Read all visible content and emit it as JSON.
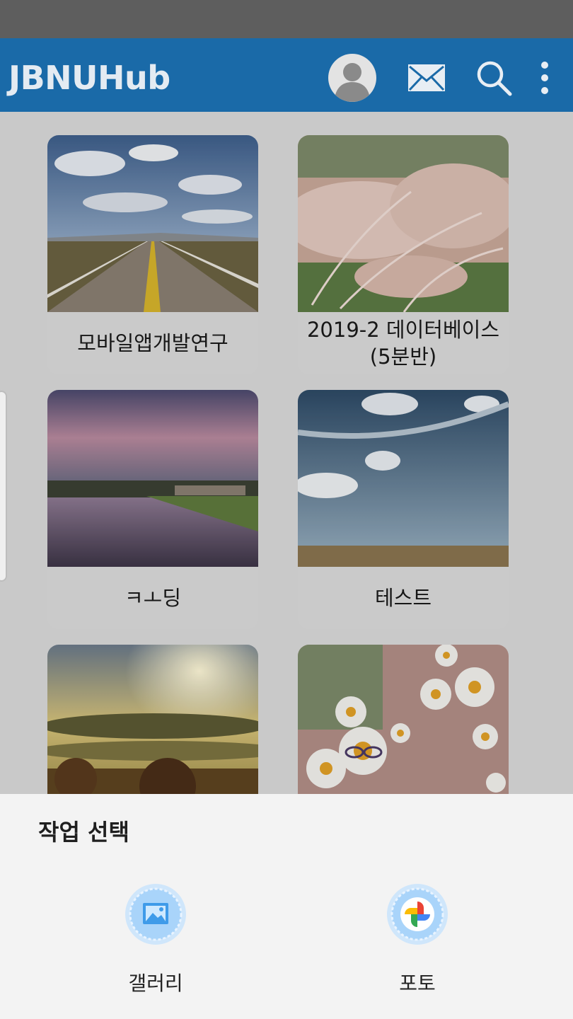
{
  "app": {
    "title": "JBNUHub"
  },
  "toolbar": {
    "icons": [
      "avatar-icon",
      "mail-icon",
      "search-icon",
      "more-vert-icon"
    ]
  },
  "cards": [
    {
      "label": "모바일앱개발연구",
      "image": "road-under-cloudy-sky"
    },
    {
      "label": "2019-2 데이터베이스\n(5분반)",
      "image": "pampas-grass"
    },
    {
      "label": "ㅋㅗ딩",
      "image": "lake-at-dusk"
    },
    {
      "label": "테스트",
      "image": "blue-sky-prairie"
    },
    {
      "label": "",
      "image": "foggy-sunrise-hills"
    },
    {
      "label": "",
      "image": "daisy-field"
    }
  ],
  "sheet": {
    "title": "작업 선택",
    "options": [
      {
        "label": "갤러리",
        "icon": "gallery-icon"
      },
      {
        "label": "포토",
        "icon": "photos-pinwheel-icon"
      }
    ]
  },
  "colors": {
    "app_bar": "#1a6aa8",
    "status_bar": "#5e5e5e",
    "background": "#c9c9c9",
    "sheet": "#f3f3f3"
  }
}
